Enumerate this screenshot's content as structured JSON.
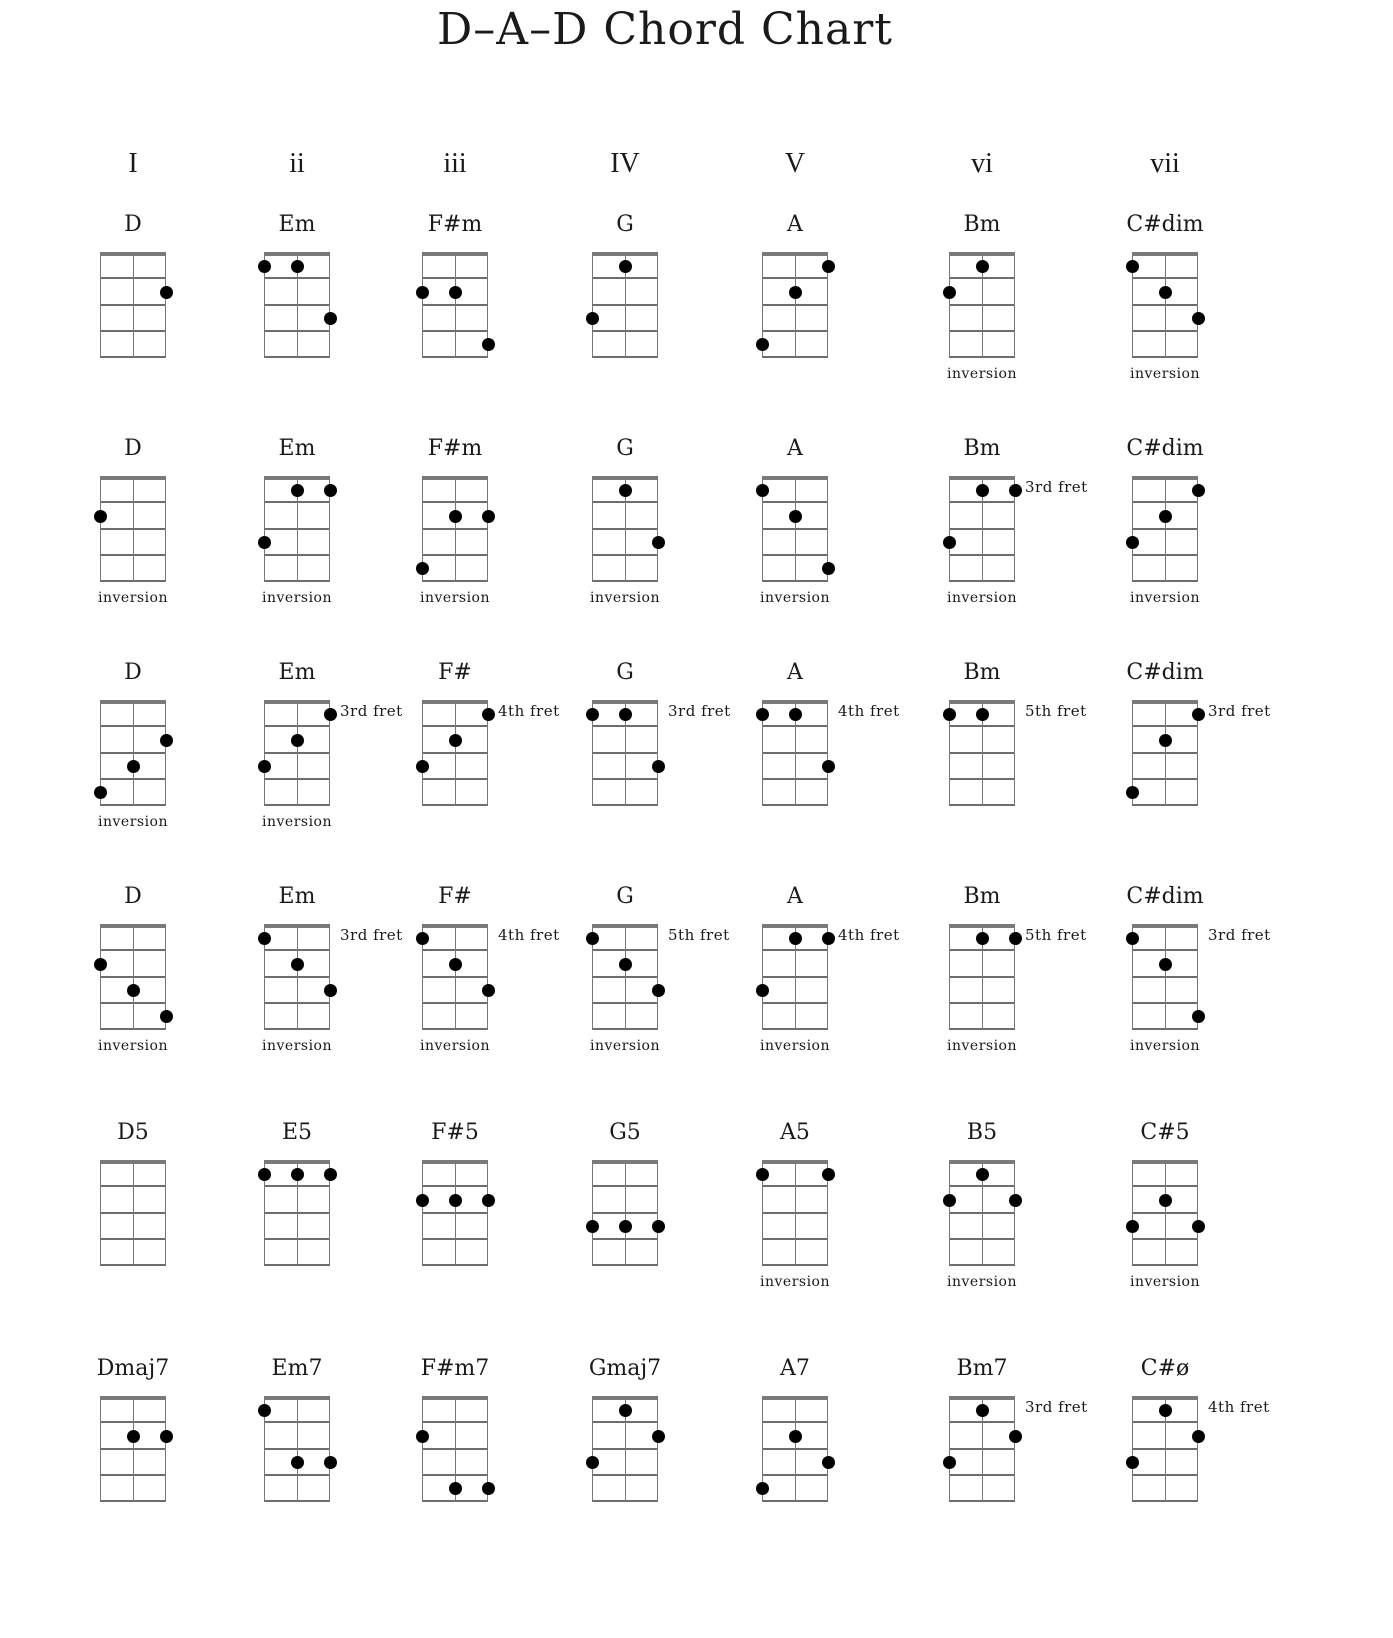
{
  "title": "D–A–D Chord Chart",
  "numerals": [
    "I",
    "ii",
    "iii",
    "IV",
    "V",
    "vi",
    "vii"
  ],
  "chart_data": {
    "type": "table",
    "tuning": "D-A-D",
    "strings": 3,
    "frets_shown": 4,
    "fret_encoding": "frets per string, left-to-right; 0 = open (no dot)",
    "rows": [
      [
        {
          "name": "D",
          "frets": [
            0,
            0,
            2
          ],
          "position": "",
          "inversion": false
        },
        {
          "name": "Em",
          "frets": [
            1,
            1,
            3
          ],
          "position": "",
          "inversion": false
        },
        {
          "name": "F#m",
          "frets": [
            2,
            2,
            4
          ],
          "position": "",
          "inversion": false
        },
        {
          "name": "G",
          "frets": [
            3,
            1,
            0
          ],
          "position": "",
          "inversion": false
        },
        {
          "name": "A",
          "frets": [
            4,
            2,
            1
          ],
          "position": "",
          "inversion": false
        },
        {
          "name": "Bm",
          "frets": [
            2,
            1,
            0
          ],
          "position": "",
          "inversion": true
        },
        {
          "name": "C#dim",
          "frets": [
            1,
            2,
            3
          ],
          "position": "",
          "inversion": true
        }
      ],
      [
        {
          "name": "D",
          "frets": [
            2,
            0,
            0
          ],
          "position": "",
          "inversion": true
        },
        {
          "name": "Em",
          "frets": [
            3,
            1,
            1
          ],
          "position": "",
          "inversion": true
        },
        {
          "name": "F#m",
          "frets": [
            4,
            2,
            2
          ],
          "position": "",
          "inversion": true
        },
        {
          "name": "G",
          "frets": [
            0,
            1,
            3
          ],
          "position": "",
          "inversion": true
        },
        {
          "name": "A",
          "frets": [
            1,
            2,
            4
          ],
          "position": "",
          "inversion": true
        },
        {
          "name": "Bm",
          "frets": [
            3,
            1,
            1
          ],
          "position": "3rd fret",
          "inversion": true
        },
        {
          "name": "C#dim",
          "frets": [
            3,
            2,
            1
          ],
          "position": "",
          "inversion": true
        }
      ],
      [
        {
          "name": "D",
          "frets": [
            4,
            3,
            2
          ],
          "position": "",
          "inversion": true
        },
        {
          "name": "Em",
          "frets": [
            3,
            2,
            1
          ],
          "position": "3rd fret",
          "inversion": true
        },
        {
          "name": "F#",
          "frets": [
            3,
            2,
            1
          ],
          "position": "4th fret",
          "inversion": false
        },
        {
          "name": "G",
          "frets": [
            1,
            1,
            3
          ],
          "position": "3rd fret",
          "inversion": false
        },
        {
          "name": "A",
          "frets": [
            1,
            1,
            3
          ],
          "position": "4th fret",
          "inversion": false
        },
        {
          "name": "Bm",
          "frets": [
            1,
            1,
            0
          ],
          "position": "5th fret",
          "inversion": false
        },
        {
          "name": "C#dim",
          "frets": [
            4,
            2,
            1
          ],
          "position": "3rd fret",
          "inversion": false
        }
      ],
      [
        {
          "name": "D",
          "frets": [
            2,
            3,
            4
          ],
          "position": "",
          "inversion": true
        },
        {
          "name": "Em",
          "frets": [
            1,
            2,
            3
          ],
          "position": "3rd fret",
          "inversion": true
        },
        {
          "name": "F#",
          "frets": [
            1,
            2,
            3
          ],
          "position": "4th fret",
          "inversion": true
        },
        {
          "name": "G",
          "frets": [
            1,
            2,
            3
          ],
          "position": "5th fret",
          "inversion": true
        },
        {
          "name": "A",
          "frets": [
            3,
            1,
            1
          ],
          "position": "4th fret",
          "inversion": true
        },
        {
          "name": "Bm",
          "frets": [
            0,
            1,
            1
          ],
          "position": "5th fret",
          "inversion": true
        },
        {
          "name": "C#dim",
          "frets": [
            1,
            2,
            4
          ],
          "position": "3rd fret",
          "inversion": true
        }
      ],
      [
        {
          "name": "D5",
          "frets": [
            0,
            0,
            0
          ],
          "position": "",
          "inversion": false
        },
        {
          "name": "E5",
          "frets": [
            1,
            1,
            1
          ],
          "position": "",
          "inversion": false
        },
        {
          "name": "F#5",
          "frets": [
            2,
            2,
            2
          ],
          "position": "",
          "inversion": false
        },
        {
          "name": "G5",
          "frets": [
            3,
            3,
            3
          ],
          "position": "",
          "inversion": false
        },
        {
          "name": "A5",
          "frets": [
            1,
            0,
            1
          ],
          "position": "",
          "inversion": true
        },
        {
          "name": "B5",
          "frets": [
            2,
            1,
            2
          ],
          "position": "",
          "inversion": true
        },
        {
          "name": "C#5",
          "frets": [
            3,
            2,
            3
          ],
          "position": "",
          "inversion": true
        }
      ],
      [
        {
          "name": "Dmaj7",
          "frets": [
            0,
            2,
            2
          ],
          "position": "",
          "inversion": false
        },
        {
          "name": "Em7",
          "frets": [
            1,
            3,
            3
          ],
          "position": "",
          "inversion": false
        },
        {
          "name": "F#m7",
          "frets": [
            2,
            4,
            4
          ],
          "position": "",
          "inversion": false
        },
        {
          "name": "Gmaj7",
          "frets": [
            3,
            1,
            2
          ],
          "position": "",
          "inversion": false
        },
        {
          "name": "A7",
          "frets": [
            4,
            2,
            3
          ],
          "position": "",
          "inversion": false
        },
        {
          "name": "Bm7",
          "frets": [
            3,
            1,
            2
          ],
          "position": "3rd fret",
          "inversion": false
        },
        {
          "name": "C#ø",
          "frets": [
            3,
            1,
            2
          ],
          "position": "4th fret",
          "inversion": false
        }
      ]
    ]
  },
  "labels": {
    "inversion": "inversion"
  }
}
